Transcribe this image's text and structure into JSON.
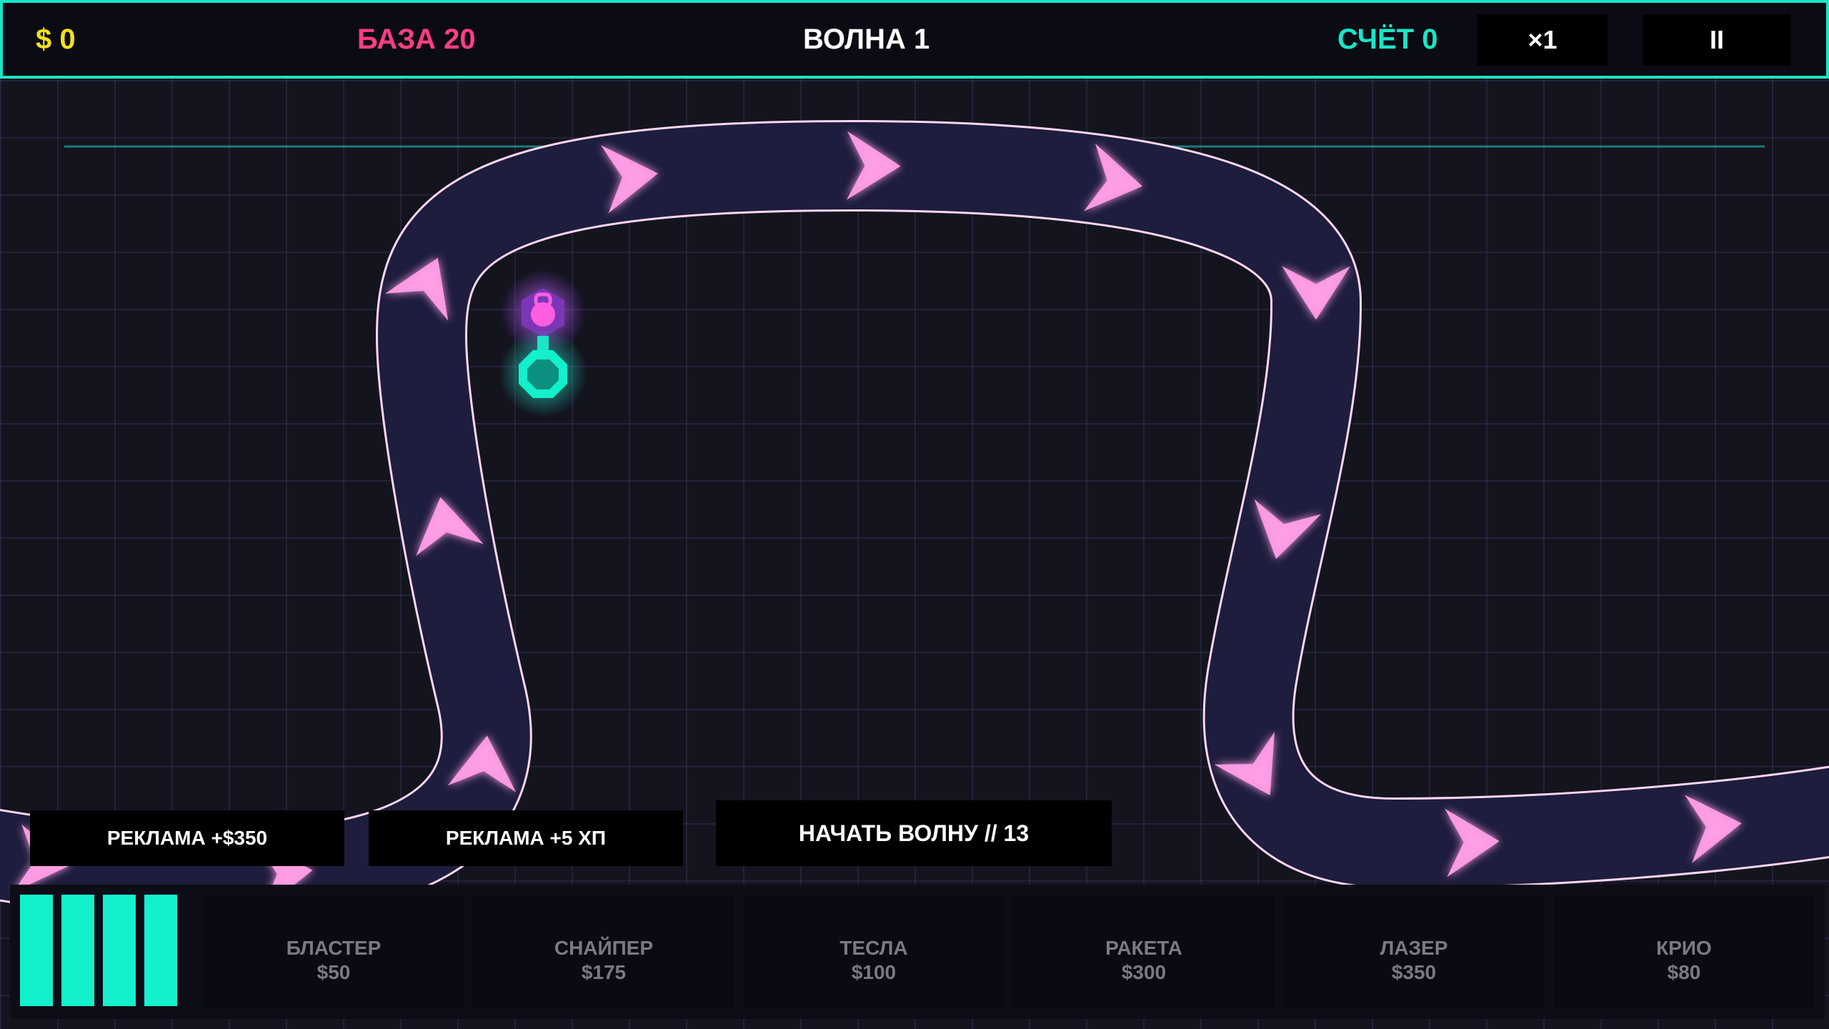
{
  "hud": {
    "money": "$ 0",
    "base": "БАЗА 20",
    "wave": "ВОЛНА 1",
    "score": "СЧЁТ 0",
    "speed_label": "×1",
    "pause_label": "II"
  },
  "actions": {
    "ad_money_label": "РЕКЛАМА  +$350",
    "ad_hp_label": "РЕКЛАМА  +5 ХП",
    "start_wave_label": "НАЧАТЬ ВОЛНУ  //  13"
  },
  "towers": [
    {
      "name": "БЛАСТЕР",
      "cost": "$50"
    },
    {
      "name": "СНАЙПЕР",
      "cost": "$175"
    },
    {
      "name": "ТЕСЛА",
      "cost": "$100"
    },
    {
      "name": "РАКЕТА",
      "cost": "$300"
    },
    {
      "name": "ЛАЗЕР",
      "cost": "$350"
    },
    {
      "name": "КРИО",
      "cost": "$80"
    }
  ],
  "colors": {
    "accent": "#19e6c6",
    "money": "#f0e01e",
    "base": "#ff3e82",
    "path_fill": "#1e1d3d",
    "path_edge": "#ffd6f2",
    "chevron": "#ff9ee6",
    "enemy": "#ff5ee0",
    "tower": "#19e6c6"
  },
  "icons": {
    "menu": "menu-bars-icon",
    "enemy": "enemy-hexagon-icon",
    "tower": "tower-octagon-icon"
  }
}
